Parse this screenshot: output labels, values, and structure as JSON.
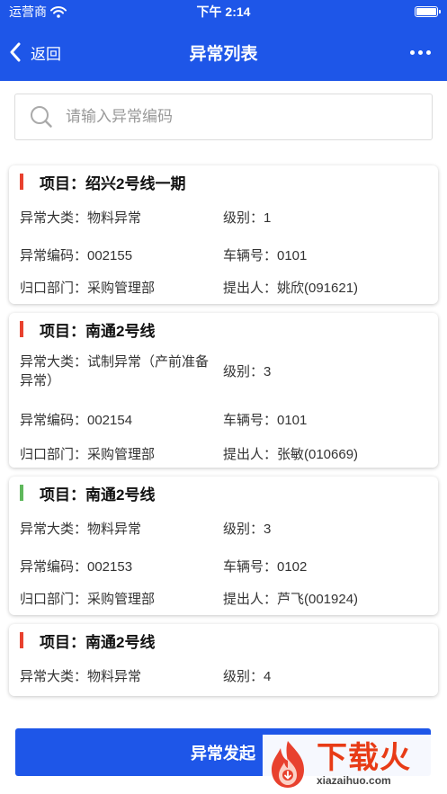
{
  "status_bar": {
    "carrier": "运营商",
    "time": "下午 2:14"
  },
  "nav": {
    "back_label": "返回",
    "title": "异常列表"
  },
  "search": {
    "placeholder": "请输入异常编码"
  },
  "cards": [
    {
      "title": "项目：绍兴2号线一期",
      "marker_color": "#e8412e",
      "category": "异常大类：物料异常",
      "level": "级别：1",
      "code": "异常编码：002155",
      "vehicle": "车辆号：0101",
      "dept": "归口部门：采购管理部",
      "submitter": "提出人：姚欣(091621)"
    },
    {
      "title": "项目：南通2号线",
      "marker_color": "#e8412e",
      "category": "异常大类：试制异常（产前准备异常）",
      "level": "级别：3",
      "code": "异常编码：002154",
      "vehicle": "车辆号：0101",
      "dept": "归口部门：采购管理部",
      "submitter": "提出人：张敏(010669)"
    },
    {
      "title": "项目：南通2号线",
      "marker_color": "#5fb85c",
      "category": "异常大类：物料异常",
      "level": "级别：3",
      "code": "异常编码：002153",
      "vehicle": "车辆号：0102",
      "dept": "归口部门：采购管理部",
      "submitter": "提出人：芦飞(001924)"
    },
    {
      "title": "项目：南通2号线",
      "marker_color": "#e8412e",
      "category": "异常大类：物料异常",
      "level": "级别：4"
    }
  ],
  "bottom_button": {
    "label": "异常发起"
  },
  "watermark": {
    "logo_main": "下载火",
    "logo_sub": "xiazaihuo.com"
  },
  "colors": {
    "primary": "#1e56e8",
    "marker_red": "#e8412e",
    "marker_green": "#5fb85c"
  }
}
